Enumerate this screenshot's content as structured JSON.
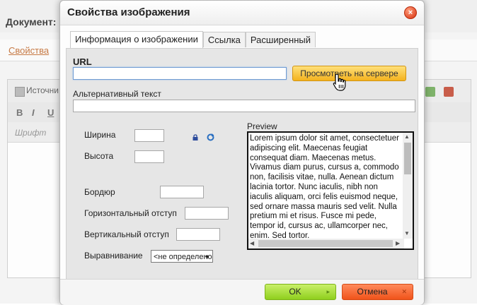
{
  "background": {
    "document_label": "Документ:",
    "properties_tab": "Свойства",
    "source_label": "Источни",
    "format_buttons": [
      "B",
      "I",
      "U"
    ],
    "font_label": "Шрифт"
  },
  "dialog": {
    "title": "Свойства изображения",
    "close_icon": "×",
    "tabs": [
      {
        "label": "Информация о изображении",
        "active": true
      },
      {
        "label": "Ссылка",
        "active": false
      },
      {
        "label": "Расширенный",
        "active": false
      }
    ],
    "url_label": "URL",
    "url_value": "",
    "browse_button": "Просмотреть на сервере",
    "alt_label": "Альтернативный текст",
    "alt_value": "",
    "width_label": "Ширина",
    "height_label": "Высота",
    "border_label": "Бордюр",
    "hspace_label": "Горизонтальный отступ",
    "vspace_label": "Вертикальный отступ",
    "align_label": "Выравнивание",
    "align_value": "<не определено>",
    "preview_label": "Preview",
    "preview_text": "Lorem ipsum dolor sit amet, consectetuer adipiscing elit. Maecenas feugiat consequat diam. Maecenas metus. Vivamus diam purus, cursus a, commodo non, facilisis vitae, nulla. Aenean dictum lacinia tortor. Nunc iaculis, nibh non iaculis aliquam, orci felis euismod neque, sed ornare massa mauris sed velit. Nulla pretium mi et risus. Fusce mi pede, tempor id, cursus ac, ullamcorper nec, enim. Sed tortor.",
    "ok_button": "OK",
    "cancel_button": "Отмена",
    "colors": {
      "ok": "#8fcf1d",
      "cancel": "#f0531a",
      "browse": "#f4b21e",
      "close": "#d6320f"
    }
  }
}
